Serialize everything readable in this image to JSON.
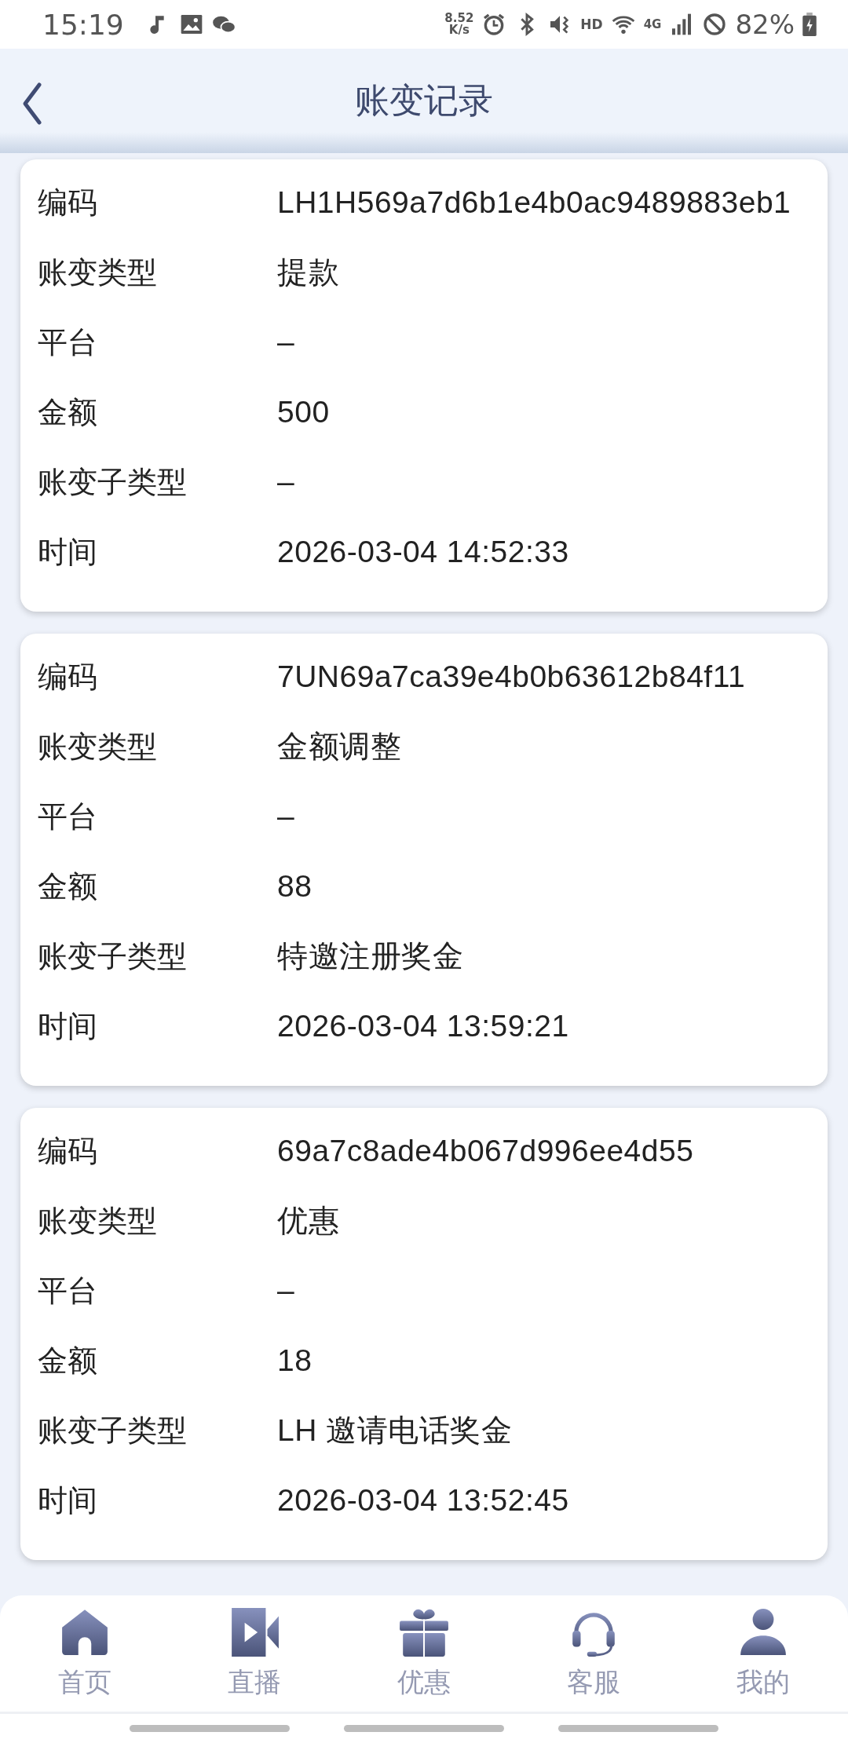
{
  "status_bar": {
    "time": "15:19",
    "net_speed": [
      "8.52",
      "K/s"
    ],
    "hd": "HD",
    "network": "4G",
    "battery": "82%"
  },
  "header": {
    "title": "账变记录"
  },
  "records": [
    {
      "fields": [
        {
          "label": "编码",
          "value": "LH1H569a7d6b1e4b0ac9489883eb1"
        },
        {
          "label": "账变类型",
          "value": "提款"
        },
        {
          "label": "平台",
          "value": "–"
        },
        {
          "label": "金额",
          "value": "500"
        },
        {
          "label": "账变子类型",
          "value": "–"
        },
        {
          "label": "时间",
          "value": "2026-03-04 14:52:33"
        }
      ]
    },
    {
      "fields": [
        {
          "label": "编码",
          "value": "7UN69a7ca39e4b0b63612b84f11"
        },
        {
          "label": "账变类型",
          "value": "金额调整"
        },
        {
          "label": "平台",
          "value": "–"
        },
        {
          "label": "金额",
          "value": "88"
        },
        {
          "label": "账变子类型",
          "value": "特邀注册奖金"
        },
        {
          "label": "时间",
          "value": "2026-03-04 13:59:21"
        }
      ]
    },
    {
      "fields": [
        {
          "label": "编码",
          "value": "69a7c8ade4b067d996ee4d55"
        },
        {
          "label": "账变类型",
          "value": "优惠"
        },
        {
          "label": "平台",
          "value": "–"
        },
        {
          "label": "金额",
          "value": "18"
        },
        {
          "label": "账变子类型",
          "value": "LH 邀请电话奖金"
        },
        {
          "label": "时间",
          "value": "2026-03-04 13:52:45"
        }
      ]
    }
  ],
  "tab_bar": [
    {
      "kind": "home",
      "label": "首页"
    },
    {
      "kind": "live",
      "label": "直播"
    },
    {
      "kind": "gift",
      "label": "优惠"
    },
    {
      "kind": "support",
      "label": "客服"
    },
    {
      "kind": "profile",
      "label": "我的"
    }
  ]
}
